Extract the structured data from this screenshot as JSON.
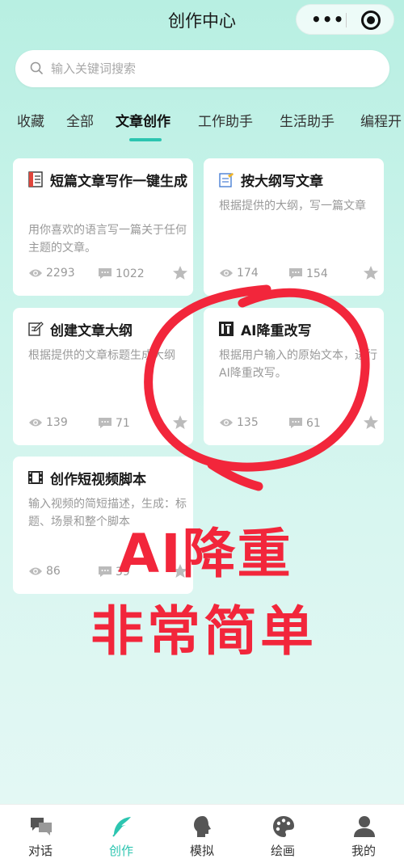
{
  "header": {
    "title": "创作中心"
  },
  "search": {
    "placeholder": "输入关键词搜索"
  },
  "tabs": [
    {
      "label": "收藏"
    },
    {
      "label": "全部"
    },
    {
      "label": "文章创作",
      "active": true
    },
    {
      "label": "工作助手"
    },
    {
      "label": "生活助手"
    },
    {
      "label": "编程开"
    }
  ],
  "cards": [
    {
      "icon": "notebook-icon",
      "title": "短篇文章写作一键生成",
      "desc": "用你喜欢的语言写一篇关于任何主题的文章。",
      "views": "2293",
      "comments": "1022"
    },
    {
      "icon": "pencil-paper-icon",
      "title": "按大纲写文章",
      "desc": "根据提供的大纲，写一篇文章",
      "views": "174",
      "comments": "154"
    },
    {
      "icon": "edit-note-icon",
      "title": "创建文章大纲",
      "desc": "根据提供的文章标题生成大纲",
      "views": "139",
      "comments": "71"
    },
    {
      "icon": "seal-icon",
      "title": "AI降重改写",
      "desc": "根据用户输入的原始文本，进行AI降重改写。",
      "views": "135",
      "comments": "61"
    },
    {
      "icon": "film-icon",
      "title": "创作短视频脚本",
      "desc": "输入视频的简短描述，生成：标题、场景和整个脚本",
      "views": "86",
      "comments": "39"
    }
  ],
  "overlay": {
    "line1": "AI降重",
    "line2": "非常简单",
    "color": "#f2263b"
  },
  "tabbar": [
    {
      "label": "对话",
      "icon": "chat-bubbles-icon"
    },
    {
      "label": "创作",
      "icon": "feather-icon",
      "active": true
    },
    {
      "label": "模拟",
      "icon": "head-profile-icon"
    },
    {
      "label": "绘画",
      "icon": "palette-icon"
    },
    {
      "label": "我的",
      "icon": "user-icon"
    }
  ],
  "colors": {
    "accent": "#2cc5b0",
    "overlay_red": "#f2263b"
  }
}
